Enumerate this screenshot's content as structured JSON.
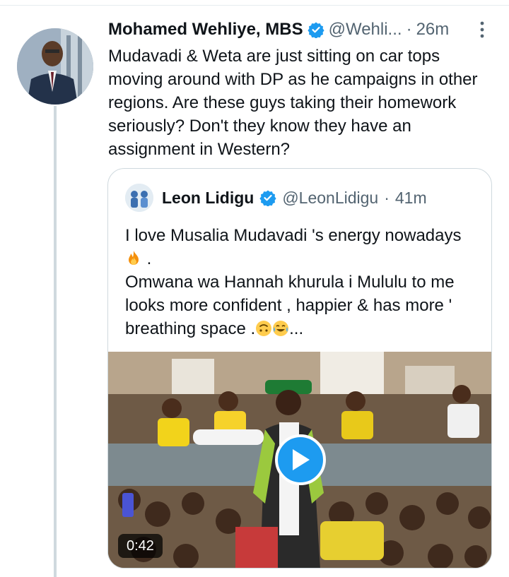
{
  "tweet": {
    "author": {
      "display_name": "Mohamed Wehliye, MBS",
      "handle": "@Wehli...",
      "verified": true
    },
    "separator": "·",
    "time": "26m",
    "text_lines": [
      "Mudavadi & Weta are just sitting on car tops",
      "moving around with DP as he campaigns in other",
      "regions. Are these guys taking their homework",
      "seriously? Don't they know they have an",
      "assignment in Western?"
    ],
    "icons": {
      "verified": "verified-badge-icon",
      "more": "more-options-icon"
    },
    "accent_color": "#1d9bf0"
  },
  "quote": {
    "author": {
      "display_name": "Leon Lidigu",
      "handle": "@LeonLidigu",
      "verified": true
    },
    "separator": "·",
    "time": "41m",
    "text": {
      "line1": "I love Musalia Mudavadi 's energy nowadays",
      "line2_suffix": " .",
      "line3": "Omwana wa Hannah khurula i Mululu to me",
      "line4": "looks more confident , happier & has more '",
      "line5_prefix": "breathing space  .",
      "line5_suffix": "..."
    },
    "emojis": [
      "fire-emoji",
      "upside-down-face-emoji",
      "face-with-tears-of-joy-emoji"
    ],
    "media": {
      "type": "video",
      "duration": "0:42",
      "play_icon": "play-icon"
    }
  }
}
